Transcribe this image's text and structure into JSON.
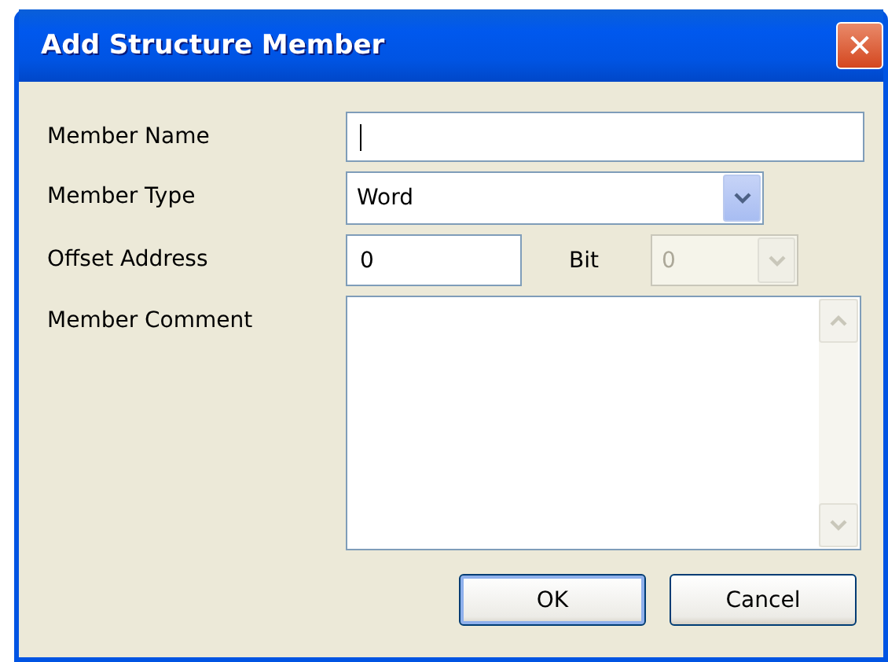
{
  "window": {
    "title": "Add Structure Member",
    "close": "✕"
  },
  "fields": [
    {
      "kind": "text",
      "label": "Member Name",
      "focused": true
    },
    {
      "kind": "combo",
      "label": "Member Type",
      "value": "Word",
      "disabled": false
    },
    {
      "kind": "offset",
      "label": "Offset Address",
      "value": "0",
      "bit_label": "Bit",
      "bit_value": "0",
      "bit_disabled": true
    },
    {
      "kind": "memo",
      "label": "Member Comment"
    }
  ],
  "buttons": [
    {
      "label": "OK",
      "default": true
    },
    {
      "label": "Cancel",
      "default": false
    }
  ]
}
